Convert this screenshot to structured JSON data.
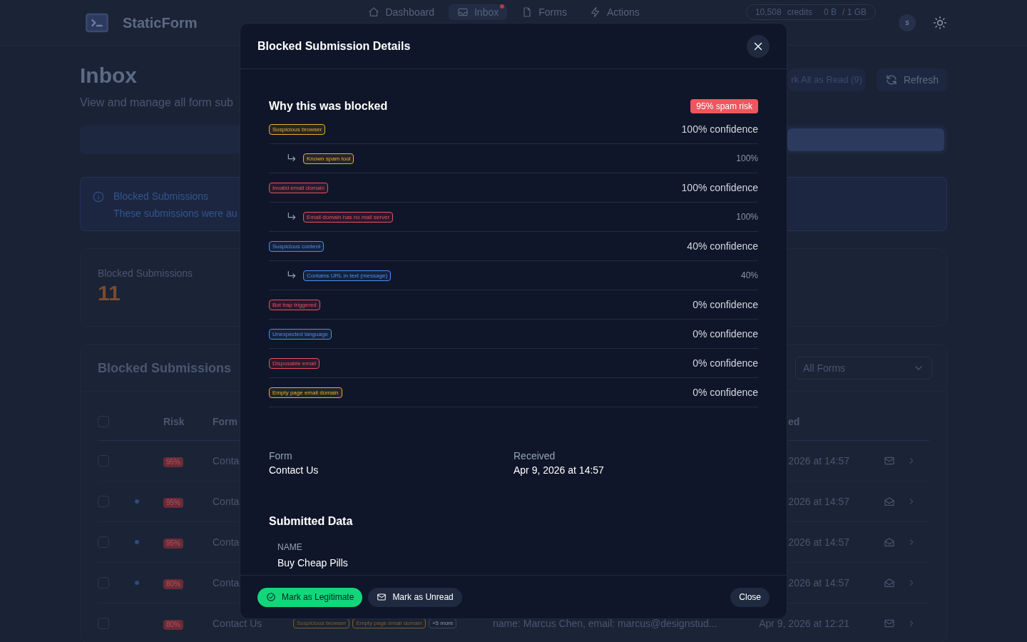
{
  "app": {
    "name": "StaticForm"
  },
  "nav": [
    {
      "label": "Dashboard",
      "selected": false,
      "badge": false
    },
    {
      "label": "Inbox",
      "selected": true,
      "badge": true
    },
    {
      "label": "Forms",
      "selected": false,
      "badge": false
    },
    {
      "label": "Actions",
      "selected": false,
      "badge": false
    }
  ],
  "usage": {
    "credits": "10,508",
    "credits_label": "credits",
    "storage": "0 B",
    "storage_total": "/ 1 GB"
  },
  "avatar": "s",
  "page": {
    "title": "Inbox",
    "subtitle": "View and manage all form sub",
    "mark_read": "rk All as Read (9)",
    "refresh": "Refresh"
  },
  "info": {
    "title": "Blocked Submissions",
    "text": "These submissions were au"
  },
  "stat": {
    "label": "Blocked Submissions",
    "value": "11"
  },
  "table": {
    "title": "Blocked Submissions",
    "filter": "All Forms",
    "select_all_checked": false,
    "columns": [
      "Risk",
      "Form",
      "ed"
    ],
    "rows": [
      {
        "checked": false,
        "unread": false,
        "risk": "95%",
        "form": "Conta",
        "received": "2026 at 14:57"
      },
      {
        "checked": false,
        "unread": true,
        "risk": "95%",
        "form": "Conta",
        "received": "2026 at 14:57"
      },
      {
        "checked": false,
        "unread": true,
        "risk": "95%",
        "form": "Conta",
        "received": "2026 at 14:57"
      },
      {
        "checked": false,
        "unread": true,
        "risk": "80%",
        "form": "Conta",
        "received": "2026 at 14:57"
      },
      {
        "checked": false,
        "unread": false,
        "risk": "80%",
        "form": "Contact Us",
        "tags": [
          {
            "label": "Suspicious browser",
            "color": "#7a6224"
          },
          {
            "label": "Empty page email domain",
            "color": "#7a6224"
          }
        ],
        "more": "+5 more",
        "preview": "name: Marcus Chen, email: marcus@designstud...",
        "received": "Apr 9, 2026 at 12:21"
      }
    ]
  },
  "modal": {
    "title": "Blocked Submission Details",
    "section_title": "Why this was blocked",
    "risk": "95% spam risk",
    "reasons": [
      {
        "label": "Suspicious browser",
        "color": "#e5b224",
        "confidence": "100% confidence",
        "children": [
          {
            "label": "Known spam tool",
            "color": "#e5b224",
            "confidence": "100%"
          }
        ]
      },
      {
        "label": "Invalid email domain",
        "color": "#ef4f5e",
        "confidence": "100% confidence",
        "children": [
          {
            "label": "Email domain has no mail server",
            "color": "#ef4f5e",
            "confidence": "100%"
          }
        ]
      },
      {
        "label": "Suspicious content",
        "color": "#4a8ff0",
        "confidence": "40% confidence",
        "children": [
          {
            "label": "Contains URL in text (message)",
            "color": "#4a8ff0",
            "confidence": "40%"
          }
        ]
      },
      {
        "label": "Bot trap triggered",
        "color": "#ef4f5e",
        "confidence": "0% confidence"
      },
      {
        "label": "Unexpected language",
        "color": "#4a8ff0",
        "confidence": "0% confidence"
      },
      {
        "label": "Disposable email",
        "color": "#ef4f5e",
        "confidence": "0% confidence"
      },
      {
        "label": "Empty page email domain",
        "color": "#e5b224",
        "confidence": "0% confidence"
      }
    ],
    "meta": [
      {
        "label": "Form",
        "value": "Contact Us"
      },
      {
        "label": "Received",
        "value": "Apr 9, 2026 at 14:57"
      }
    ],
    "data_title": "Submitted Data",
    "fields": [
      {
        "label": "NAME",
        "value": "Buy Cheap Pills"
      }
    ],
    "buttons": [
      {
        "kind": "primary",
        "label": "Mark as Legitimate"
      },
      {
        "kind": "secondary",
        "label": "Mark as Unread"
      },
      {
        "kind": "close",
        "label": "Close"
      }
    ]
  }
}
